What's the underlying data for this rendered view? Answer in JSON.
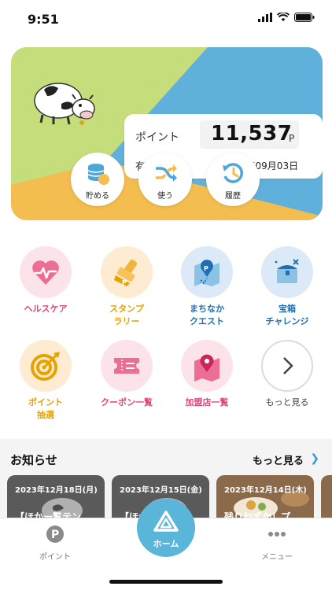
{
  "status_bar": {
    "time": "9:51"
  },
  "point_card": {
    "point_label": "ポイント",
    "point_value": "11,537",
    "point_unit": "P",
    "expiry_label": "有効期限",
    "expiry_value": "2024年09月03日",
    "actions": [
      {
        "label": "貯める",
        "icon": "coin-stack-icon"
      },
      {
        "label": "使う",
        "icon": "shuffle-icon"
      },
      {
        "label": "履歴",
        "icon": "history-icon"
      }
    ]
  },
  "features": [
    {
      "label_lines": [
        "ヘルスケア"
      ],
      "icon": "heart-pulse-icon",
      "color": "#e0457b",
      "bg": "#fce3ea"
    },
    {
      "label_lines": [
        "スタンプ",
        "ラリー"
      ],
      "icon": "stamp-icon",
      "color": "#e8a200",
      "bg": "#fdebd2"
    },
    {
      "label_lines": [
        "まちなか",
        "クエスト"
      ],
      "icon": "map-pin-icon",
      "color": "#1f6fb5",
      "bg": "#dbeaf6"
    },
    {
      "label_lines": [
        "宝箱",
        "チャレンジ"
      ],
      "icon": "treasure-chest-icon",
      "color": "#1f6fb5",
      "bg": "#dbeaf6"
    },
    {
      "label_lines": [
        "ポイント",
        "抽選"
      ],
      "icon": "target-icon",
      "color": "#e8a200",
      "bg": "#fdebd2"
    },
    {
      "label_lines": [
        "クーポン一覧"
      ],
      "icon": "ticket-icon",
      "color": "#e0457b",
      "bg": "#fce3ea"
    },
    {
      "label_lines": [
        "加盟店一覧"
      ],
      "icon": "map-icon",
      "color": "#e0457b",
      "bg": "#fce3ea"
    },
    {
      "label_lines": [
        "もっと見る"
      ],
      "icon": "chevron-right-icon",
      "color": "#444444",
      "bg": "#ffffff"
    }
  ],
  "news": {
    "title": "お知らせ",
    "more_label": "もっと見る",
    "items": [
      {
        "date": "2023年12月18日(月)",
        "headline": "【ほか一覧テン"
      },
      {
        "date": "2023年12月15日(金)",
        "headline": "【ほか一覧テン"
      },
      {
        "date": "2023年12月14日(木)",
        "headline": "残りわずかしプ"
      }
    ]
  },
  "tab_bar": {
    "tabs": [
      {
        "label": "ポイント",
        "icon": "point-p-icon"
      },
      {
        "label": "ホーム",
        "icon": "home-triangle-icon"
      },
      {
        "label": "メニュー",
        "icon": "more-dots-icon"
      }
    ]
  },
  "colors": {
    "card_green": "#c5dd7a",
    "card_blue": "#5fb1db",
    "card_yellow": "#f3bd50",
    "pink": "#e0457b",
    "orange": "#e8a200",
    "blue": "#1f6fb5",
    "home_button": "#5ab6d9"
  }
}
